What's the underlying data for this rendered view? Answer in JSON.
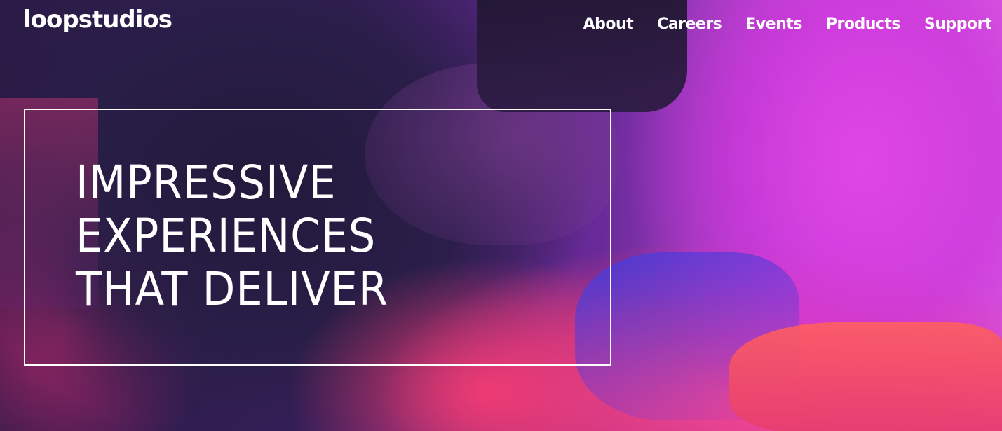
{
  "header": {
    "logo": "loopstudios",
    "nav": [
      {
        "label": "About"
      },
      {
        "label": "Careers"
      },
      {
        "label": "Events"
      },
      {
        "label": "Products"
      },
      {
        "label": "Support"
      }
    ]
  },
  "hero": {
    "title_lines": [
      "IMPRESSIVE",
      "EXPERIENCES",
      "THAT DELIVER"
    ]
  },
  "colors": {
    "text": "#ffffff",
    "accent_magenta": "#d65ae0",
    "accent_pink": "#f0407a",
    "dark": "#2a1a45"
  }
}
